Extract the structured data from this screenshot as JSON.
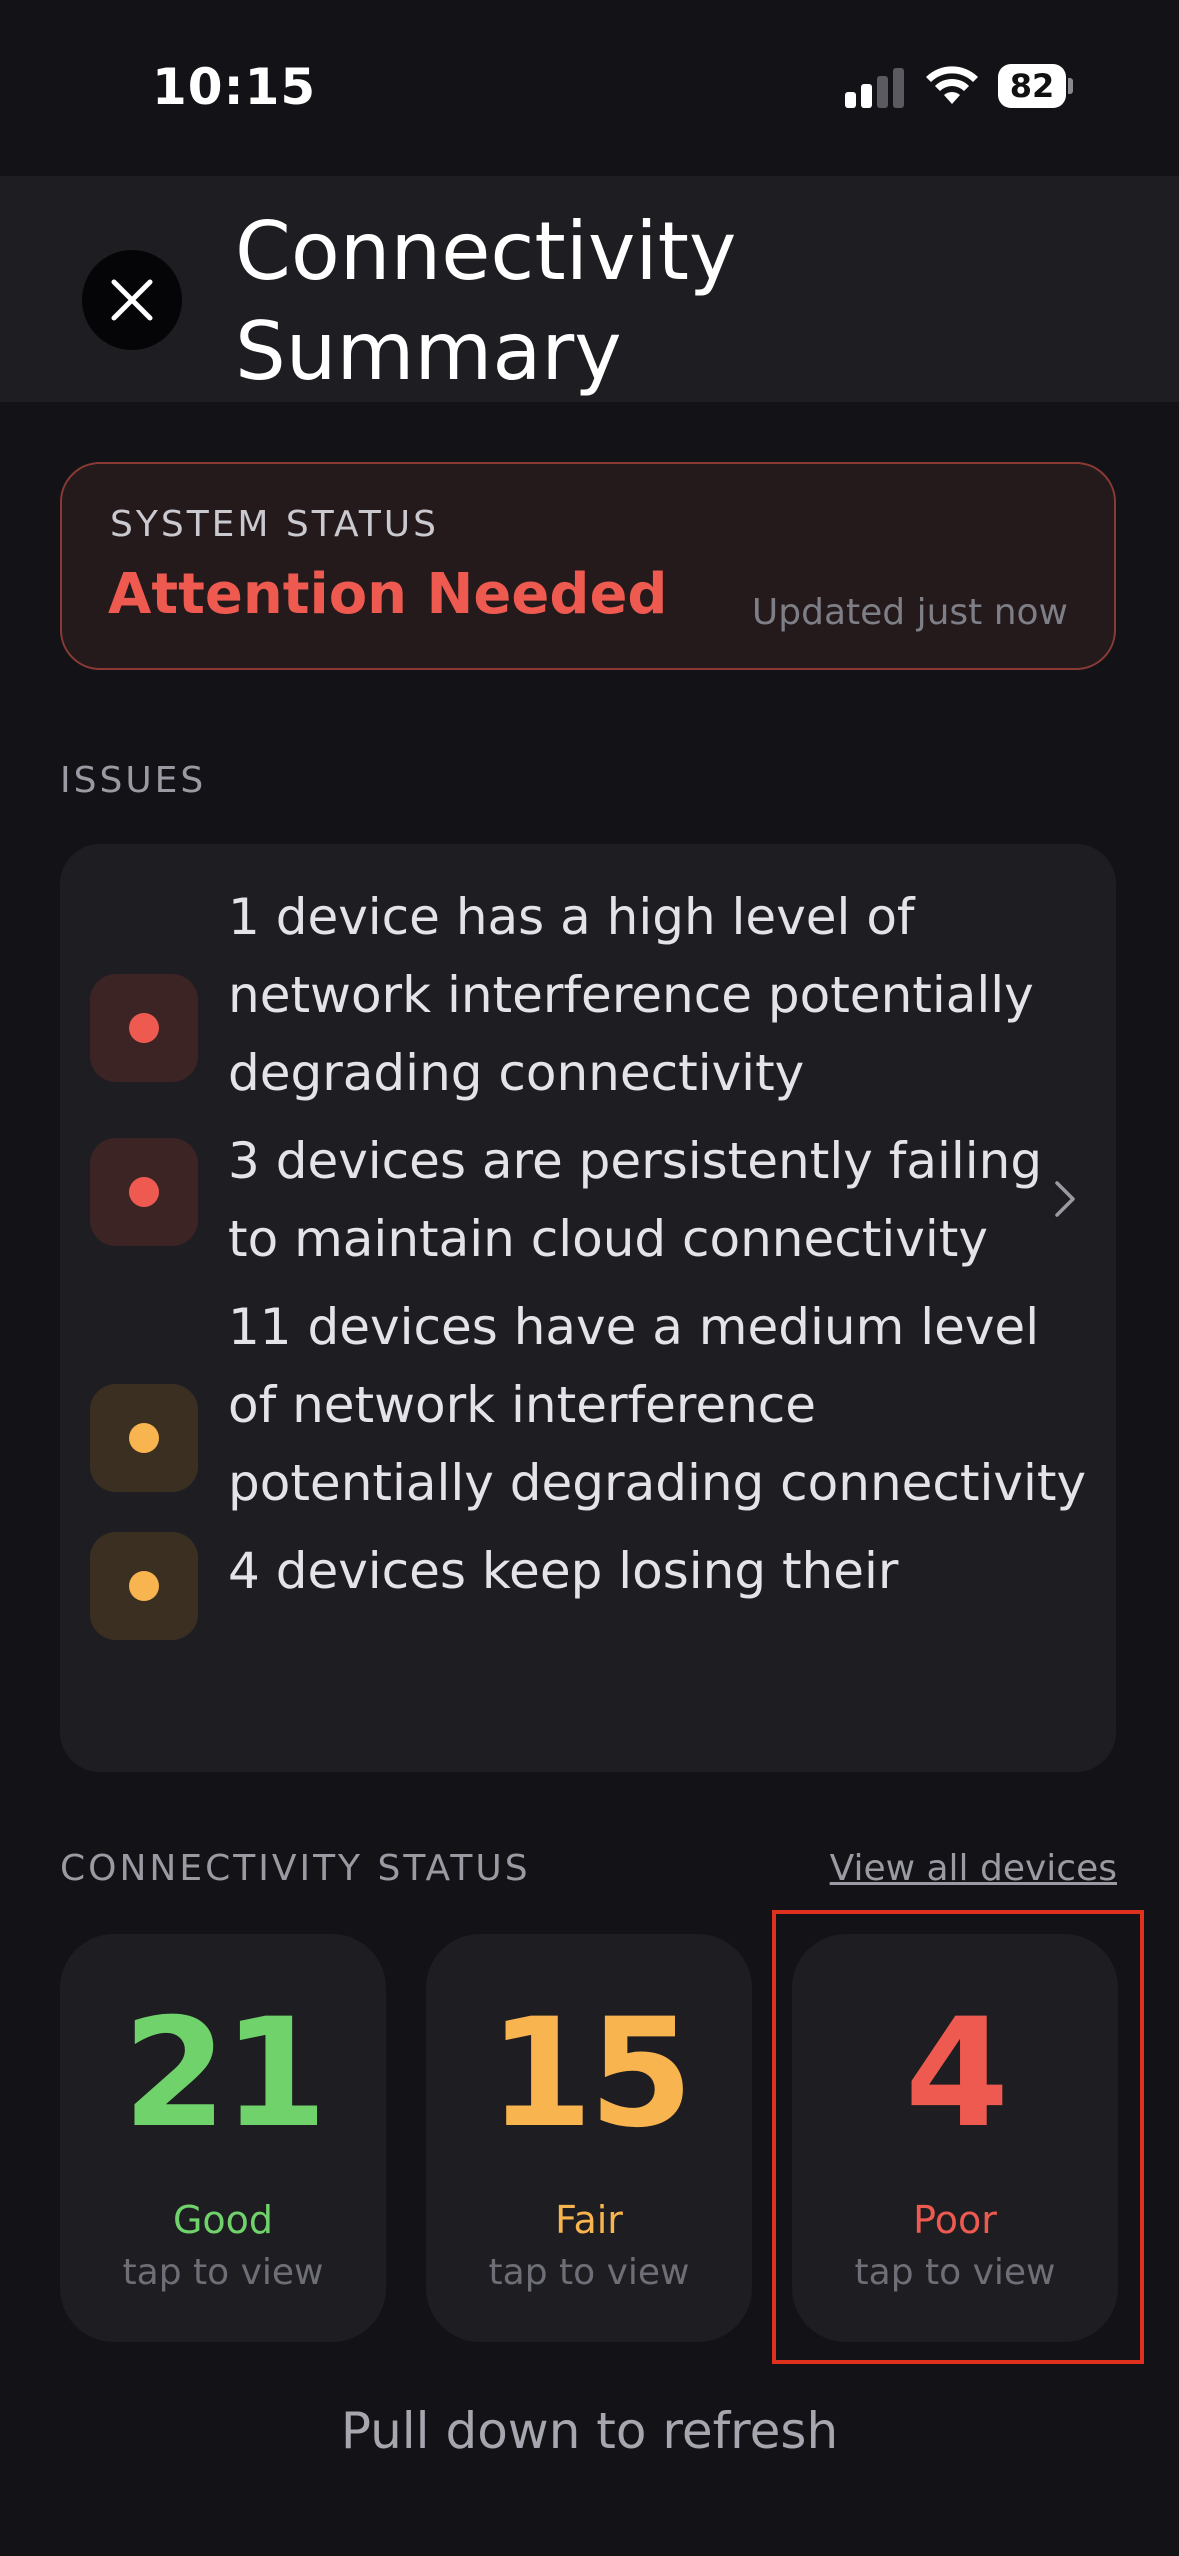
{
  "status_bar": {
    "time": "10:15",
    "battery": "82",
    "icons": [
      "signal-icon",
      "wifi-icon",
      "battery-icon"
    ]
  },
  "header": {
    "title": "Connectivity Summary",
    "close_icon": "close-icon"
  },
  "system_status": {
    "label": "SYSTEM STATUS",
    "value": "Attention Needed",
    "updated": "Updated just now",
    "color": "#ee5a4f"
  },
  "issues": {
    "label": "ISSUES",
    "items": [
      {
        "text": "1 device has a high level of network interference potentially degrading connectivity",
        "severity": "high"
      },
      {
        "text": "3 devices are persistently failing to maintain cloud connectivity",
        "severity": "high"
      },
      {
        "text": "11 devices have a medium level of network interference potentially degrading connectivity",
        "severity": "medium"
      },
      {
        "text": "4 devices keep losing their",
        "severity": "medium"
      }
    ]
  },
  "connectivity": {
    "label": "CONNECTIVITY STATUS",
    "view_all": "View all devices",
    "tiles": [
      {
        "count": "21",
        "label": "Good",
        "sub": "tap to view",
        "color": "#6fd26a"
      },
      {
        "count": "15",
        "label": "Fair",
        "sub": "tap to view",
        "color": "#f8b44e"
      },
      {
        "count": "4",
        "label": "Poor",
        "sub": "tap to view",
        "color": "#ee5a4f"
      }
    ]
  },
  "footer": {
    "refresh_hint": "Pull down to refresh"
  },
  "colors": {
    "background": "#131317",
    "surface": "#1e1e22",
    "high_severity": "#ee5a4f",
    "medium_severity": "#f8b44e",
    "good": "#6fd26a"
  }
}
